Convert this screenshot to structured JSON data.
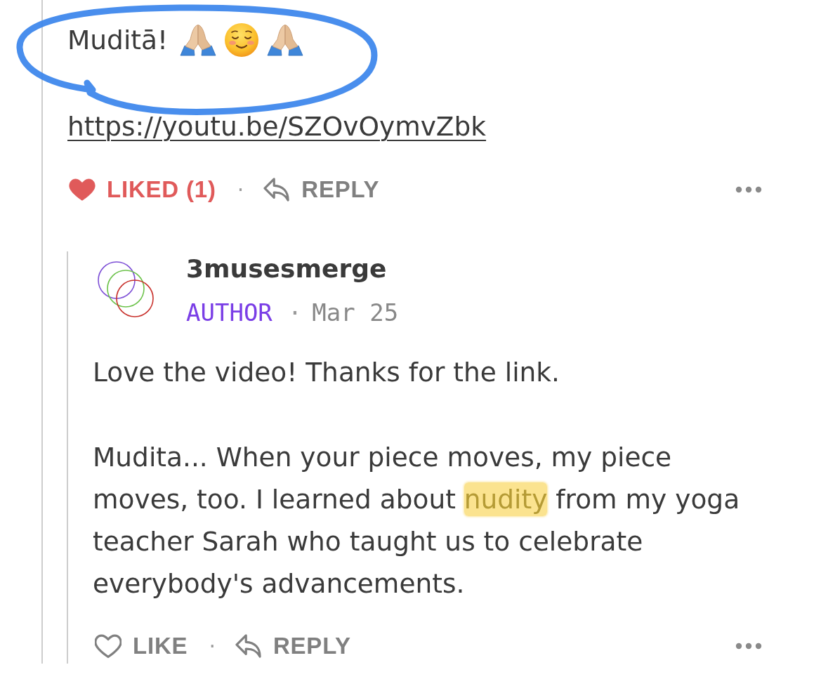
{
  "comment": {
    "text": "Muditā!",
    "emojis": [
      {
        "kind": "folded-hands"
      },
      {
        "kind": "smiling-face"
      },
      {
        "kind": "folded-hands"
      }
    ],
    "link": "https://youtu.be/SZOvOymvZbk",
    "actions": {
      "like": {
        "label": "LIKED (1)",
        "liked": true
      },
      "separator": "·",
      "reply": {
        "label": "REPLY"
      }
    }
  },
  "reply": {
    "author": "3musesmerge",
    "badge": "AUTHOR",
    "separator": "·",
    "date": "Mar 25",
    "paragraphs": [
      [
        {
          "text": "Love the video! Thanks for the link.",
          "highlighted": false
        }
      ],
      [
        {
          "text": "Mudita... When your piece moves, my piece moves, too. I learned about ",
          "highlighted": false
        },
        {
          "text": "nudity",
          "highlighted": true
        },
        {
          "text": " from my yoga teacher Sarah who taught us to celebrate everybody's advancements.",
          "highlighted": false
        }
      ]
    ],
    "actions": {
      "like": {
        "label": "LIKE",
        "liked": false
      },
      "separator": "·",
      "reply": {
        "label": "REPLY"
      }
    }
  }
}
